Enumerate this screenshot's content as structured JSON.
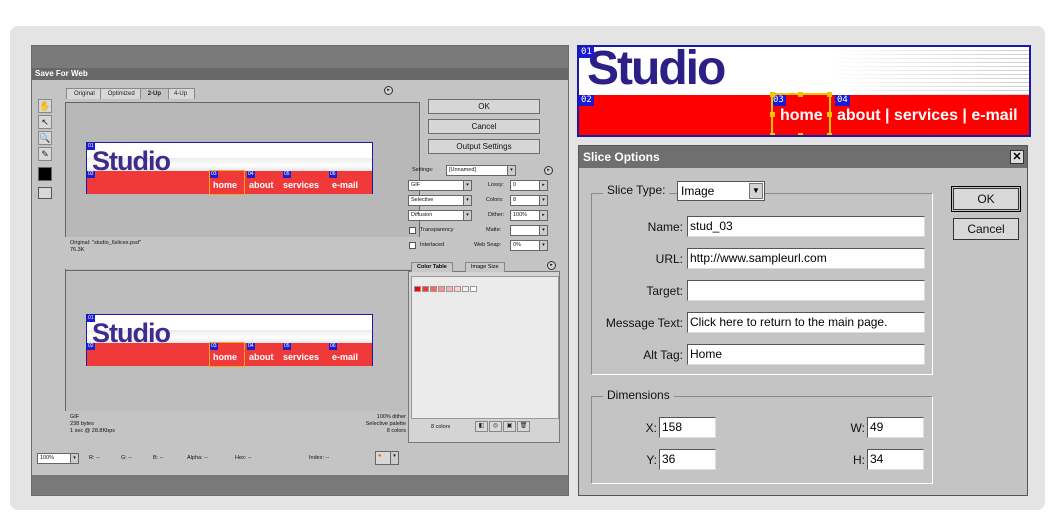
{
  "save_for_web": {
    "title": "Save For Web",
    "tabs": [
      "Original",
      "Optimized",
      "2-Up",
      "4-Up"
    ],
    "active_tab": "2-Up",
    "buttons": {
      "ok": "OK",
      "cancel": "Cancel",
      "output_settings": "Output Settings"
    },
    "settings": {
      "settings_label": "Settings:",
      "settings_value": "[Unnamed]",
      "format": "GIF",
      "lossy_label": "Lossy:",
      "lossy_value": "0",
      "reduction": "Selective",
      "colors_label": "Colors:",
      "colors_value": "8",
      "dither_algo": "Diffusion",
      "dither_label": "Dither:",
      "dither_value": "100%",
      "transparency_label": "Transparency",
      "matte_label": "Matte:",
      "interlaced_label": "Interlaced",
      "websnap_label": "Web Snap:",
      "websnap_value": "0%"
    },
    "color_table": {
      "tab1": "Color Table",
      "tab2": "Image Size",
      "count": "8 colors"
    },
    "pane1_info": {
      "line1": "Original: \"studio_6slices.psd\"",
      "line2": "76.3K"
    },
    "pane2_info": {
      "line1": "GIF",
      "line2": "238 bytes",
      "line3": "1 sec @ 28.8Kbps",
      "r1": "100% dither",
      "r2": "Selective palette",
      "r3": "8 colors"
    },
    "status": {
      "zoom": "100%",
      "r": "R: --",
      "g": "G: --",
      "b": "B: --",
      "alpha": "Alpha: --",
      "hex": "Hex: --",
      "index": "Index: --"
    },
    "mini_banner": {
      "word": "Studio",
      "links": [
        "home",
        "about",
        "services",
        "e-mail"
      ],
      "tags": [
        "01",
        "02",
        "03",
        "04",
        "05",
        "06"
      ]
    },
    "colors": [
      "#ff0000",
      "#ff3030",
      "#ff6060",
      "#ff9090",
      "#ffb0b0",
      "#ffd0d0",
      "#ffe8e8",
      "#ffffff"
    ]
  },
  "banner": {
    "word": "Studio",
    "tags": [
      "01",
      "02",
      "03",
      "04"
    ],
    "links": [
      "home",
      "about | services | e-mail"
    ]
  },
  "slice_options": {
    "title": "Slice Options",
    "slice_type_label": "Slice Type:",
    "slice_type_value": "Image",
    "fields": {
      "name_label": "Name:",
      "name_value": "stud_03",
      "url_label": "URL:",
      "url_value": "http://www.sampleurl.com",
      "target_label": "Target:",
      "target_value": "",
      "message_label": "Message Text:",
      "message_value": "Click here to return to the main page.",
      "alt_label": "Alt Tag:",
      "alt_value": "Home"
    },
    "dimensions": {
      "legend": "Dimensions",
      "x_label": "X:",
      "x_value": "158",
      "y_label": "Y:",
      "y_value": "36",
      "w_label": "W:",
      "w_value": "49",
      "h_label": "H:",
      "h_value": "34"
    },
    "buttons": {
      "ok": "OK",
      "cancel": "Cancel"
    },
    "close_glyph": "✕"
  }
}
